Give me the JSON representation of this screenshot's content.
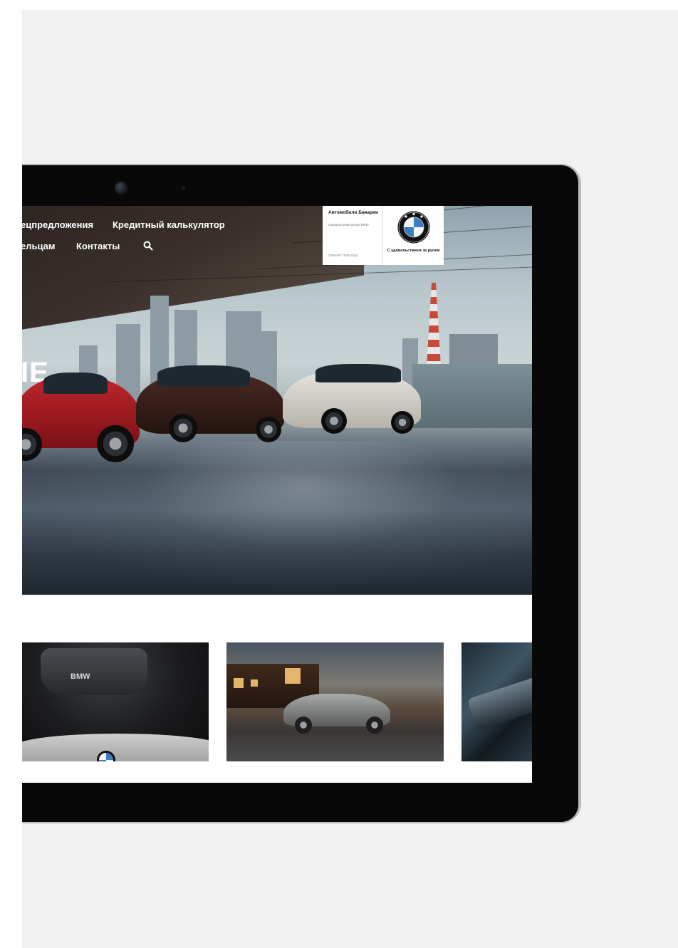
{
  "nav": {
    "row1": [
      "ецпредложения",
      "Кредитный калькулятор"
    ],
    "row2": [
      "ельцам",
      "Контакты"
    ]
  },
  "hero": {
    "text": "IE"
  },
  "dealer": {
    "name": "Автомобили Баварии",
    "subtitle": "Официальный дилер BMW",
    "city": "Нижний Новгород"
  },
  "brand": {
    "slogan": "С удовольствием за рулем"
  },
  "thumbnails": {
    "engine_text": "BMW"
  },
  "icons": {
    "search": "search-icon",
    "logo": "bmw-roundel-icon",
    "camera": "front-camera-icon"
  },
  "colors": {
    "bmw_blue": "#3b7cc3",
    "tablet_black": "#080808",
    "page_bg": "#f1f1f1"
  }
}
